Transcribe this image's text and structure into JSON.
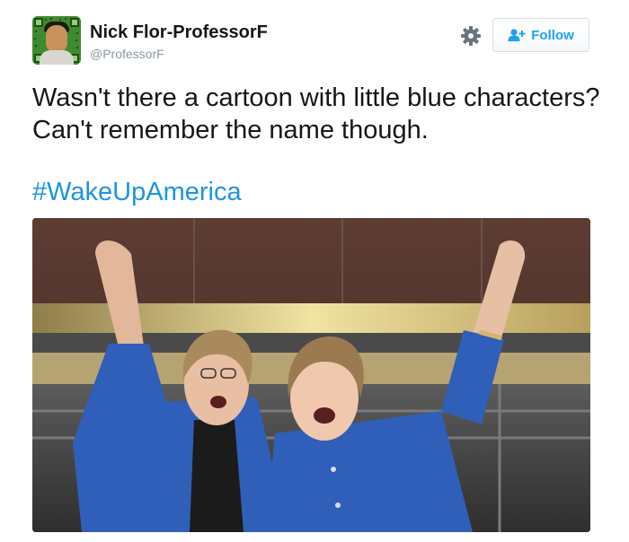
{
  "tweet": {
    "author": {
      "name": "Nick Flor-ProfessorF",
      "handle": "@ProfessorF",
      "avatar_icon": "profile-avatar-qr"
    },
    "actions": {
      "settings_icon": "gear-icon",
      "follow_label": "Follow",
      "follow_icon": "follow-person-plus-icon",
      "follow_color": "#1da1f2"
    },
    "text": "Wasn't there a cartoon with little blue characters? Can't remember the name though.",
    "hashtag": "#WakeUpAmerica",
    "hashtag_color": "#1b95e0",
    "media": {
      "type": "photo",
      "dominant_colors": [
        "#2f5fb8",
        "#3a302c",
        "#e0cf8a"
      ]
    }
  }
}
